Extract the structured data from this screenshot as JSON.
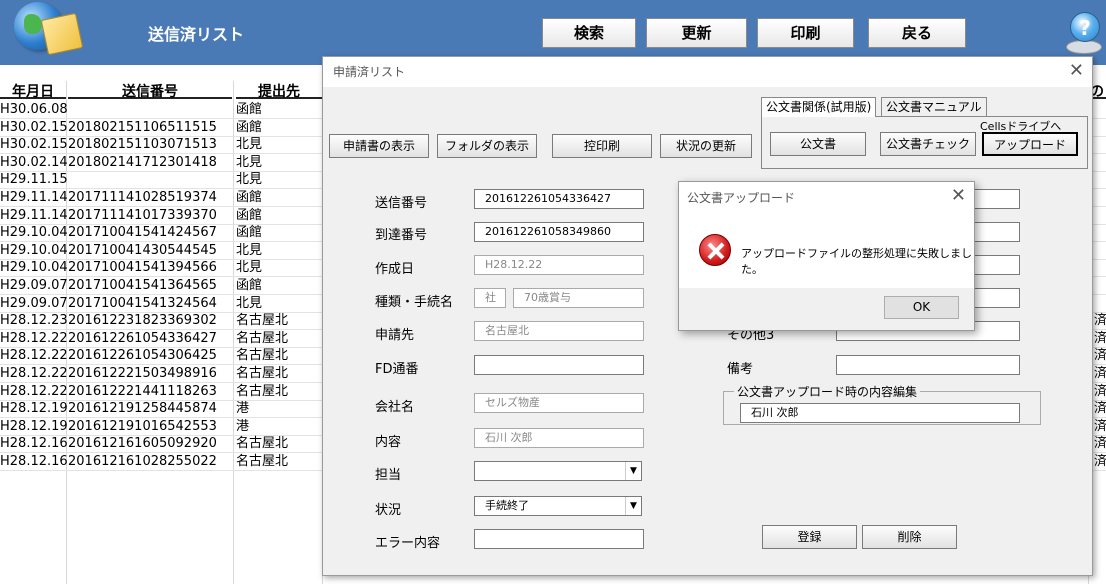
{
  "app": {
    "title": "送信済リスト"
  },
  "toolbar": {
    "search": "検索",
    "refresh": "更新",
    "print": "印刷",
    "back": "戻る",
    "help": "?"
  },
  "sheet": {
    "headers": [
      "年月日",
      "送信番号",
      "提出先"
    ],
    "right_header": "の",
    "rows": [
      [
        "H30.06.08",
        "",
        "函館"
      ],
      [
        "H30.02.15",
        "201802151106511515",
        "函館"
      ],
      [
        "H30.02.15",
        "201802151103071513",
        "北見"
      ],
      [
        "H30.02.14",
        "201802141712301418",
        "北見"
      ],
      [
        "H29.11.15",
        "",
        "北見"
      ],
      [
        "H29.11.14",
        "201711141028519374",
        "函館"
      ],
      [
        "H29.11.14",
        "201711141017339370",
        "函館"
      ],
      [
        "H29.10.04",
        "201710041541424567",
        "函館"
      ],
      [
        "H29.10.04",
        "201710041430544545",
        "北見"
      ],
      [
        "H29.10.04",
        "201710041541394566",
        "北見"
      ],
      [
        "H29.09.07",
        "201710041541364565",
        "函館"
      ],
      [
        "H29.09.07",
        "201710041541324564",
        "北見"
      ],
      [
        "H28.12.23",
        "201612231823369302",
        "名古屋北"
      ],
      [
        "H28.12.22",
        "201612261054336427",
        "名古屋北"
      ],
      [
        "H28.12.22",
        "201612261054306425",
        "名古屋北"
      ],
      [
        "H28.12.22",
        "201612221503498916",
        "名古屋北"
      ],
      [
        "H28.12.22",
        "201612221441118263",
        "名古屋北"
      ],
      [
        "H28.12.19",
        "201612191258445874",
        "港"
      ],
      [
        "H28.12.19",
        "201612191016542553",
        "港"
      ],
      [
        "H28.12.16",
        "201612161605092920",
        "名古屋北"
      ],
      [
        "H28.12.16",
        "201612161028255022",
        "名古屋北"
      ]
    ],
    "right_status": [
      "済",
      "済",
      "済",
      "済",
      "済",
      "済",
      "済",
      "済",
      "済"
    ]
  },
  "window": {
    "title": "申請済リスト",
    "buttons": {
      "show_app": "申請書の表示",
      "show_folder": "フォルダの表示",
      "print_copy": "控印刷",
      "update_status": "状況の更新"
    },
    "tabs": [
      "公文書関係(試用版)",
      "公文書マニュアル"
    ],
    "tab_buttons": {
      "doc": "公文書",
      "doc_check": "公文書チェック",
      "upload": "アップロード",
      "cells_drive": "Cellsドライブへ"
    },
    "fields": {
      "send_no": {
        "label": "送信番号",
        "value": "201612261054336427"
      },
      "arrival_no": {
        "label": "到達番号",
        "value": "201612261058349860"
      },
      "created": {
        "label": "作成日",
        "value": "H28.12.22"
      },
      "kind": {
        "label": "種類・手続名",
        "value1": "社",
        "value2": "70歳賞与"
      },
      "dest": {
        "label": "申請先",
        "value": "名古屋北"
      },
      "fd": {
        "label": "FD通番",
        "value": ""
      },
      "company": {
        "label": "会社名",
        "value": "セルズ物産"
      },
      "content": {
        "label": "内容",
        "value": "石川 次郎"
      },
      "person": {
        "label": "担当",
        "value": ""
      },
      "status": {
        "label": "状況",
        "value": "手続終了"
      },
      "error": {
        "label": "エラー内容",
        "value": ""
      }
    },
    "right": {
      "other3_label": "その他3",
      "notes_label": "備考",
      "group_caption": "公文書アップロード時の内容編集",
      "group_value": "石川 次郎"
    },
    "register": "登録",
    "delete": "削除"
  },
  "dialog": {
    "title": "公文書アップロード",
    "message": "アップロードファイルの整形処理に失敗しました。",
    "ok": "OK"
  }
}
